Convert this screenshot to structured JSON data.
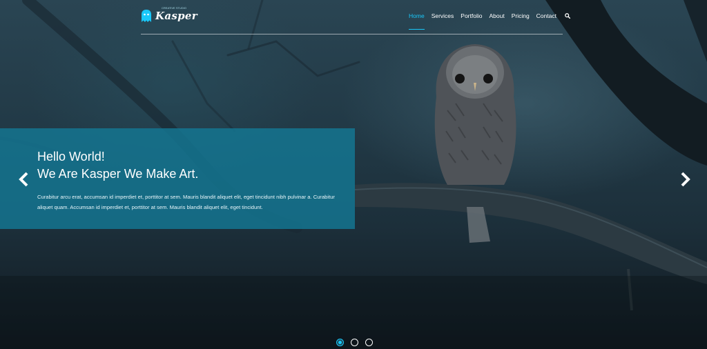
{
  "brand": {
    "name": "Kasper",
    "tagline": "CREATIVE STUDIO",
    "color": "#19c8fa"
  },
  "nav": {
    "items": [
      {
        "label": "Home",
        "active": true
      },
      {
        "label": "Services",
        "active": false
      },
      {
        "label": "Portfolio",
        "active": false
      },
      {
        "label": "About",
        "active": false
      },
      {
        "label": "Pricing",
        "active": false
      },
      {
        "label": "Contact",
        "active": false
      }
    ],
    "search_icon": "search-icon"
  },
  "slider": {
    "heading_line1": "Hello World!",
    "heading_line2": "We Are Kasper We Make Art.",
    "text": "Curabitur arcu erat, accumsan id imperdiet et, porttitor at sem. Mauris blandit aliquet elit, eget tincidunt nibh pulvinar a. Curabitur aliquet quam. Accumsan id imperdiet et, porttitor at sem. Mauris blandit aliquet elit, eget tincidunt.",
    "prev_icon": "chevron-left-icon",
    "next_icon": "chevron-right-icon",
    "dots": [
      {
        "active": true
      },
      {
        "active": false
      },
      {
        "active": false
      }
    ],
    "caption_color": "#14788f"
  }
}
